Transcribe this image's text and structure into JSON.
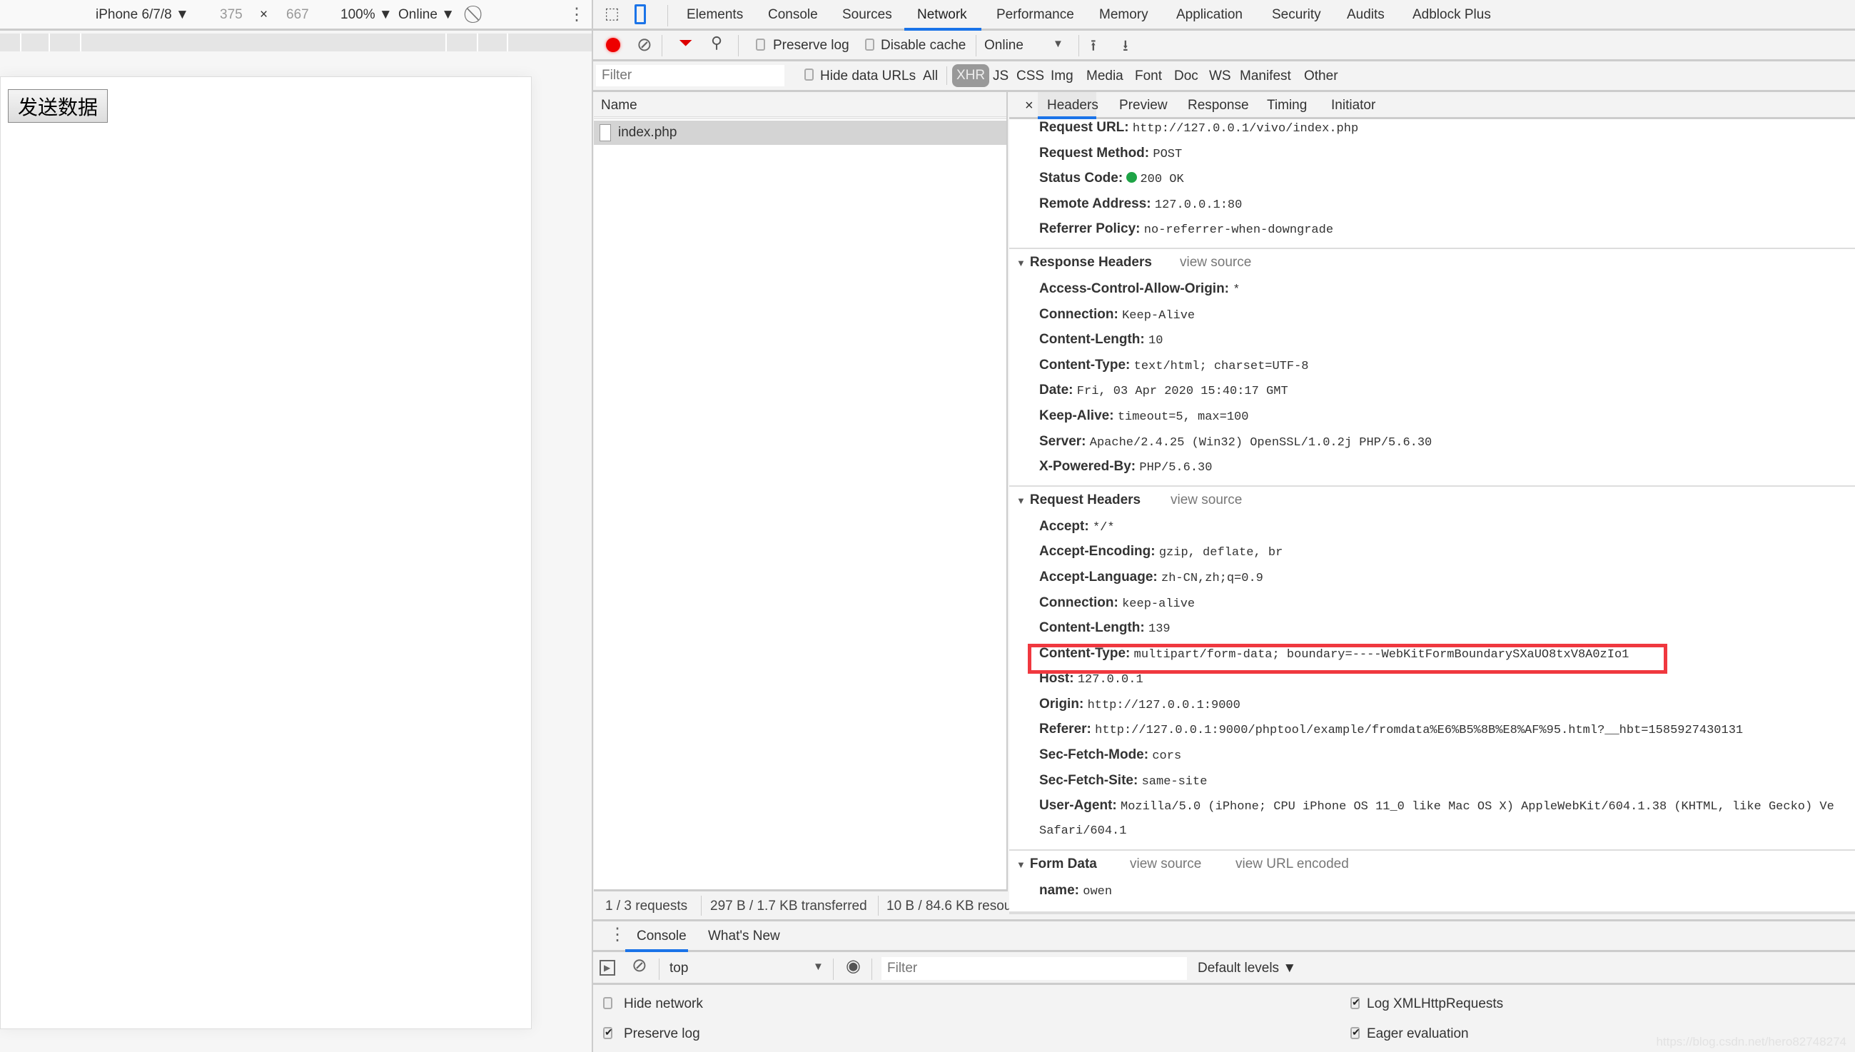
{
  "device": {
    "model": "iPhone 6/7/8 ▼",
    "width": "375",
    "times": "×",
    "height": "667",
    "zoom": "100% ▼",
    "throttle": "Online ▼"
  },
  "page": {
    "button": "发送数据"
  },
  "tabs": [
    "Elements",
    "Console",
    "Sources",
    "Network",
    "Performance",
    "Memory",
    "Application",
    "Security",
    "Audits",
    "Adblock Plus"
  ],
  "active_tab": "Network",
  "network_toolbar": {
    "preserve_log": "Preserve log",
    "preserve_log_checked": false,
    "disable_cache": "Disable cache",
    "disable_cache_checked": false,
    "throttle": "Online",
    "throttle_arrow": "▼"
  },
  "filter_bar": {
    "placeholder": "Filter",
    "hide_data_urls": "Hide data URLs",
    "types": [
      "All",
      "XHR",
      "JS",
      "CSS",
      "Img",
      "Media",
      "Font",
      "Doc",
      "WS",
      "Manifest",
      "Other"
    ],
    "active_type": "XHR"
  },
  "requests": {
    "header": "Name",
    "rows": [
      {
        "name": "index.php"
      }
    ]
  },
  "status": {
    "requests": "1 / 3 requests",
    "transferred": "297 B / 1.7 KB transferred",
    "resources": "10 B / 84.6 KB resou"
  },
  "detail_tabs": {
    "close": "×",
    "items": [
      "Headers",
      "Preview",
      "Response",
      "Timing",
      "Initiator"
    ],
    "active": "Headers"
  },
  "general": [
    {
      "k": "Request URL:",
      "v": "http://127.0.0.1/vivo/index.php"
    },
    {
      "k": "Request Method:",
      "v": "POST"
    },
    {
      "k": "Status Code:",
      "v": "200 OK",
      "status_color": "#1ea446"
    },
    {
      "k": "Remote Address:",
      "v": "127.0.0.1:80"
    },
    {
      "k": "Referrer Policy:",
      "v": "no-referrer-when-downgrade"
    }
  ],
  "response_headers": {
    "title": "Response Headers",
    "view_source": "view source",
    "items": [
      {
        "k": "Access-Control-Allow-Origin:",
        "v": "*"
      },
      {
        "k": "Connection:",
        "v": "Keep-Alive"
      },
      {
        "k": "Content-Length:",
        "v": "10"
      },
      {
        "k": "Content-Type:",
        "v": "text/html; charset=UTF-8"
      },
      {
        "k": "Date:",
        "v": "Fri, 03 Apr 2020 15:40:17 GMT"
      },
      {
        "k": "Keep-Alive:",
        "v": "timeout=5, max=100"
      },
      {
        "k": "Server:",
        "v": "Apache/2.4.25 (Win32) OpenSSL/1.0.2j PHP/5.6.30"
      },
      {
        "k": "X-Powered-By:",
        "v": "PHP/5.6.30"
      }
    ]
  },
  "request_headers": {
    "title": "Request Headers",
    "view_source": "view source",
    "items": [
      {
        "k": "Accept:",
        "v": "*/*"
      },
      {
        "k": "Accept-Encoding:",
        "v": "gzip, deflate, br"
      },
      {
        "k": "Accept-Language:",
        "v": "zh-CN,zh;q=0.9"
      },
      {
        "k": "Connection:",
        "v": "keep-alive"
      },
      {
        "k": "Content-Length:",
        "v": "139"
      },
      {
        "k": "Content-Type:",
        "v": "multipart/form-data; boundary=----WebKitFormBoundarySXaUO8txV8A0zIo1",
        "highlighted": true
      },
      {
        "k": "Host:",
        "v": "127.0.0.1"
      },
      {
        "k": "Origin:",
        "v": "http://127.0.0.1:9000"
      },
      {
        "k": "Referer:",
        "v": "http://127.0.0.1:9000/phptool/example/fromdata%E6%B5%8B%E8%AF%95.html?__hbt=1585927430131"
      },
      {
        "k": "Sec-Fetch-Mode:",
        "v": "cors"
      },
      {
        "k": "Sec-Fetch-Site:",
        "v": "same-site"
      },
      {
        "k": "User-Agent:",
        "v": "Mozilla/5.0 (iPhone; CPU iPhone OS 11_0 like Mac OS X) AppleWebKit/604.1.38 (KHTML, like Gecko) Ve"
      }
    ],
    "ua_continuation": "Safari/604.1"
  },
  "form_data": {
    "title": "Form Data",
    "view_source": "view source",
    "view_url_encoded": "view URL encoded",
    "items": [
      {
        "k": "name:",
        "v": "owen"
      }
    ]
  },
  "highlight_color": "#f0383f",
  "drawer": {
    "tabs": [
      "Console",
      "What's New"
    ],
    "active": "Console",
    "context": "top",
    "filter_placeholder": "Filter",
    "levels": "Default levels ▼",
    "settings": [
      {
        "label": "Hide network",
        "checked": false
      },
      {
        "label": "Preserve log",
        "checked": true
      },
      {
        "label": "Log XMLHttpRequests",
        "checked": true
      },
      {
        "label": "Eager evaluation",
        "checked": true
      }
    ]
  },
  "watermark": "https://blog.csdn.net/hero82748274"
}
